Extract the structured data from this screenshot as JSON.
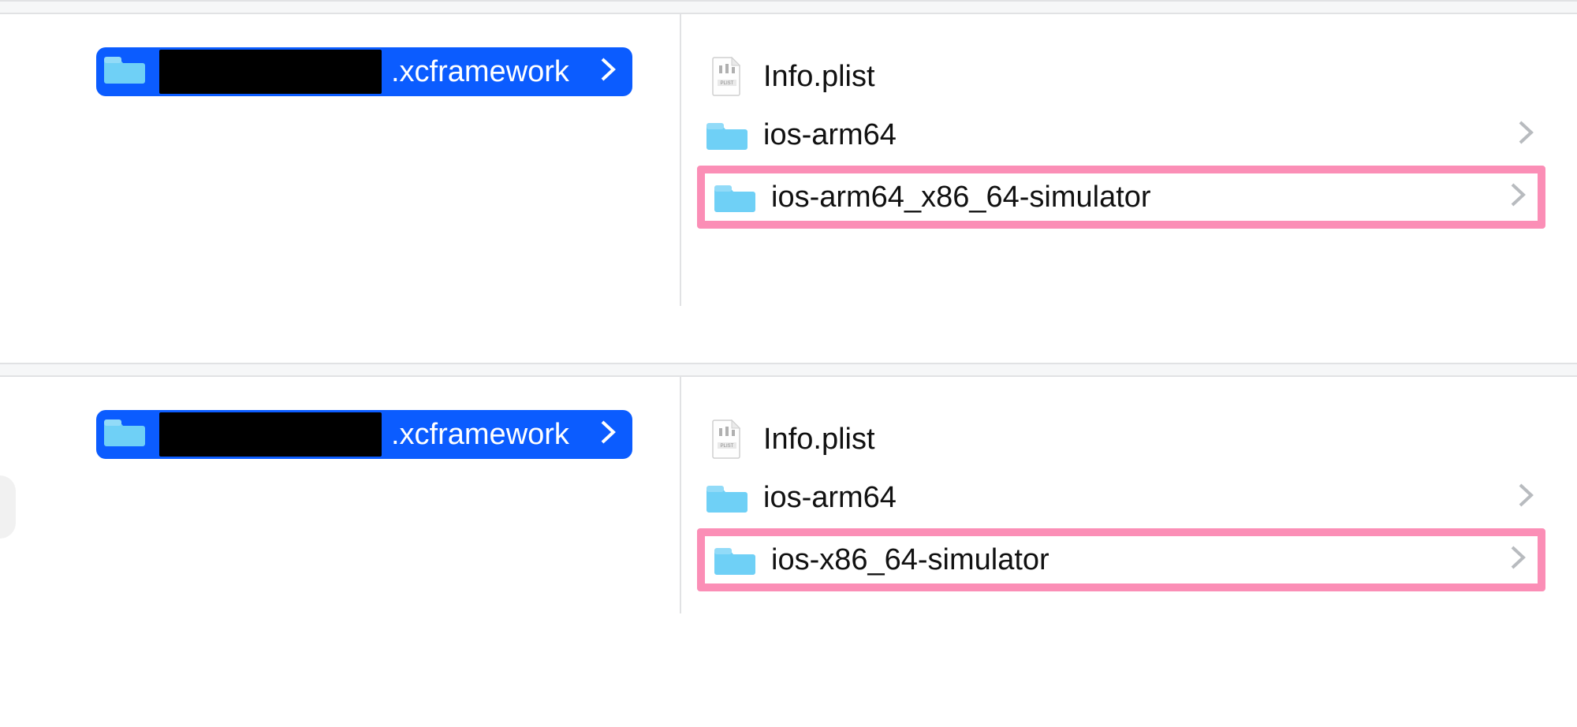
{
  "sections": [
    {
      "selected_folder_suffix": ".xcframework",
      "items": [
        {
          "name": "Info.plist",
          "type": "plist",
          "chevron": false,
          "highlighted": false
        },
        {
          "name": "ios-arm64",
          "type": "folder",
          "chevron": true,
          "highlighted": false
        },
        {
          "name": "ios-arm64_x86_64-simulator",
          "type": "folder",
          "chevron": true,
          "highlighted": true
        }
      ]
    },
    {
      "selected_folder_suffix": ".xcframework",
      "items": [
        {
          "name": "Info.plist",
          "type": "plist",
          "chevron": false,
          "highlighted": false
        },
        {
          "name": "ios-arm64",
          "type": "folder",
          "chevron": true,
          "highlighted": false
        },
        {
          "name": "ios-x86_64-simulator",
          "type": "folder",
          "chevron": true,
          "highlighted": true
        }
      ]
    }
  ],
  "colors": {
    "selection_blue": "#0b5cff",
    "folder_blue": "#5ec8f2",
    "highlight_pink": "#fb8eb6"
  }
}
